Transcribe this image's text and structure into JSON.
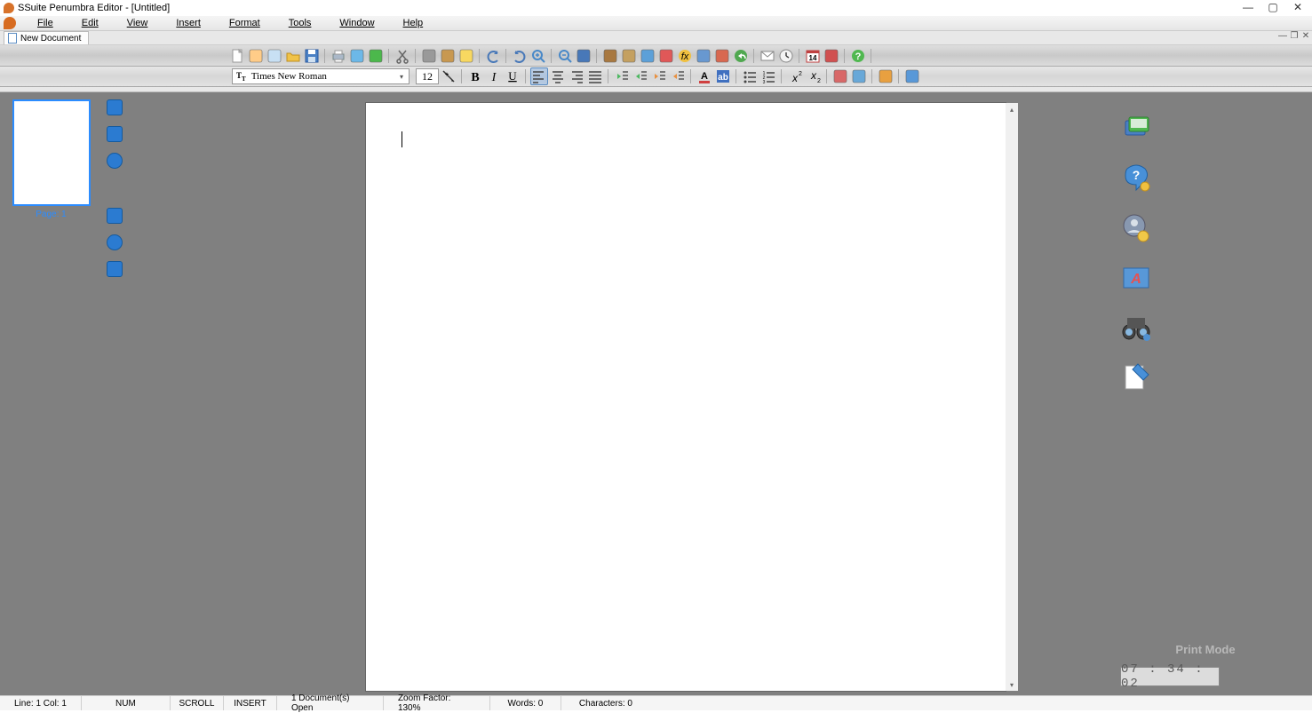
{
  "title": "SSuite Penumbra Editor - [Untitled]",
  "menu": [
    "File",
    "Edit",
    "View",
    "Insert",
    "Format",
    "Tools",
    "Window",
    "Help"
  ],
  "doc_tab": "New Document",
  "font": {
    "name": "Times New Roman",
    "size": "12"
  },
  "toolbar1_names": [
    "new",
    "edit-doc",
    "copy-doc",
    "open",
    "save",
    "print",
    "print-preview",
    "spellcheck",
    "cut",
    "copy",
    "paste",
    "highlighter",
    "undo",
    "redo",
    "zoom-in",
    "zoom-out",
    "database",
    "options",
    "clipboard",
    "table",
    "picture",
    "formula",
    "window",
    "shapes",
    "reply",
    "mail",
    "time",
    "calendar",
    "present",
    "help"
  ],
  "toolbar2_names": [
    "font-size-inc",
    "bold",
    "italic",
    "underline",
    "align-left",
    "align-center",
    "align-right",
    "justify",
    "indent-left",
    "indent-right",
    "outdent-block",
    "indent-block",
    "font-color",
    "bg-color",
    "bullet-list",
    "number-list",
    "superscript",
    "subscript",
    "properties",
    "text-props",
    "home",
    "fullscreen"
  ],
  "left_sidebar": {
    "thumb_label": "Page: 1",
    "icons": [
      "note-icon",
      "chat-icon",
      "history-icon",
      "print-icon",
      "globe-icon",
      "film-icon"
    ]
  },
  "right_sidebar": {
    "icons": [
      "monitor-stack-icon",
      "help-bubble-icon",
      "profile-badge-icon",
      "wordart-icon",
      "binoculars-icon",
      "bookmark-icon"
    ],
    "print_mode": "Print Mode",
    "clock": "07 : 34 : 02"
  },
  "status": {
    "linecol": "Line:  1  Col:  1",
    "num": "NUM",
    "scroll": "SCROLL",
    "insert": "INSERT",
    "docs_open": "1 Document(s) Open",
    "zoom": "Zoom Factor: 130%",
    "words": "Words: 0",
    "chars": "Characters: 0"
  },
  "calendar_day": "14"
}
